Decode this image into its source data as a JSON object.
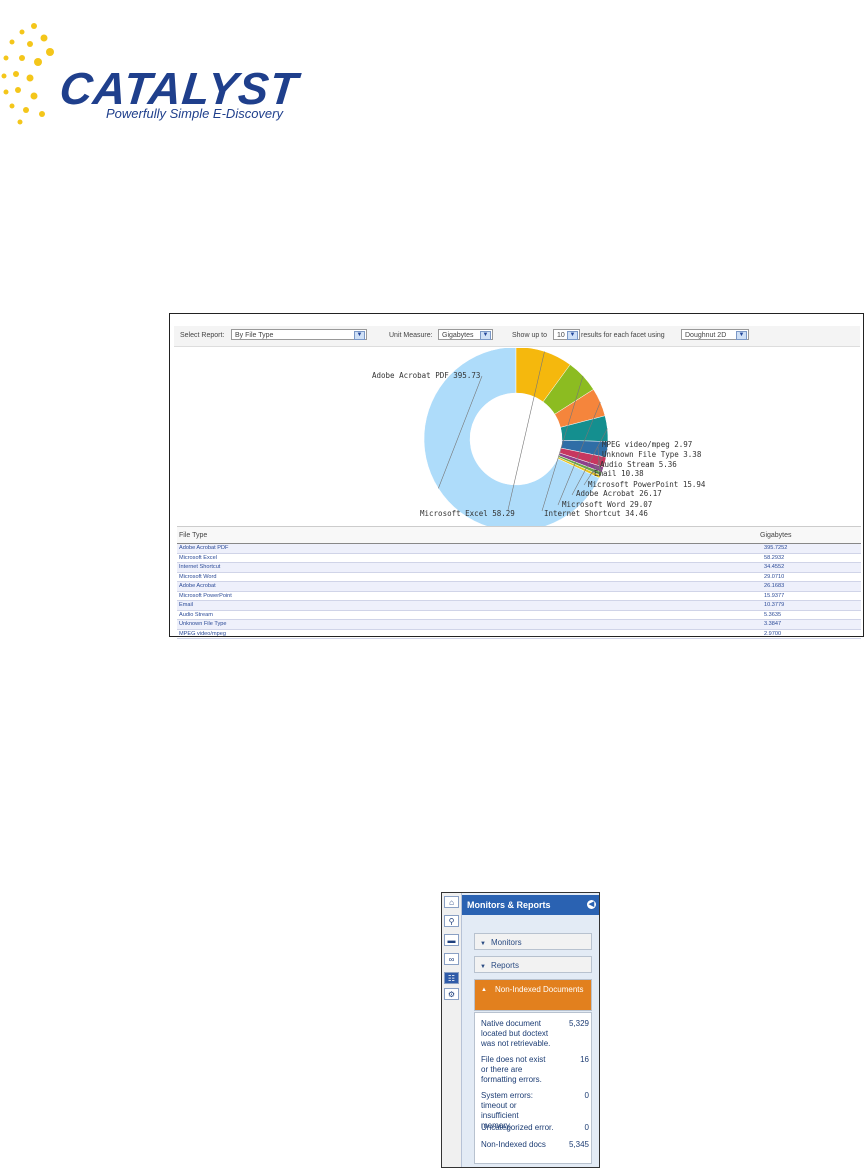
{
  "logo": {
    "brand": "CATALYST",
    "tagline": "Powerfully Simple E-Discovery",
    "colors": {
      "text": "#1f3f8c",
      "rays": "#f4c61a"
    }
  },
  "toolbar": {
    "select_report_label": "Select Report:",
    "select_report_value": "By File Type",
    "unit_label": "Unit Measure:",
    "unit_value": "Gigabytes",
    "show_prefix": "Show up to",
    "show_value": "10",
    "show_suffix": "results for each facet using",
    "chart_type_value": "Doughnut 2D"
  },
  "chart_data": {
    "type": "doughnut",
    "categories": [
      "Adobe Acrobat PDF",
      "Microsoft Excel",
      "Internet Shortcut",
      "Microsoft Word",
      "Adobe Acrobat",
      "Microsoft PowerPoint",
      "Email",
      "Audio Stream",
      "Unknown File Type",
      "MPEG video/mpeg"
    ],
    "values": [
      395.73,
      58.29,
      34.46,
      29.07,
      26.17,
      15.94,
      10.38,
      5.36,
      3.38,
      2.97
    ],
    "labels": [
      "Adobe Acrobat PDF 395.73",
      "Microsoft Excel 58.29",
      "Internet Shortcut 34.46",
      "Microsoft Word 29.07",
      "Adobe Acrobat 26.17",
      "Microsoft PowerPoint 15.94",
      "Email 10.38",
      "Audio Stream 5.36",
      "Unknown File Type 3.38",
      "MPEG video/mpeg 2.97"
    ],
    "colors": [
      "#aedcfa",
      "#f5b80d",
      "#8cbc21",
      "#f5853c",
      "#148f8f",
      "#2f6ea6",
      "#c7375f",
      "#8d3f8c",
      "#6aa845",
      "#e8c422"
    ]
  },
  "table": {
    "col_type": "File Type",
    "col_unit": "Gigabytes",
    "rows": [
      {
        "type": "Adobe Acrobat PDF",
        "value": "395.7252"
      },
      {
        "type": "Microsoft Excel",
        "value": "58.2932"
      },
      {
        "type": "Internet Shortcut",
        "value": "34.4552"
      },
      {
        "type": "Microsoft Word",
        "value": "29.0710"
      },
      {
        "type": "Adobe Acrobat",
        "value": "26.1683"
      },
      {
        "type": "Microsoft PowerPoint",
        "value": "15.9377"
      },
      {
        "type": "Email",
        "value": "10.3779"
      },
      {
        "type": "Audio Stream",
        "value": "5.3635"
      },
      {
        "type": "Unknown File Type",
        "value": "3.3847"
      },
      {
        "type": "MPEG video/mpeg",
        "value": "2.9700"
      }
    ]
  },
  "panel": {
    "title": "Monitors & Reports",
    "monitors": "Monitors",
    "reports": "Reports",
    "non_indexed": "Non-Indexed Documents",
    "entries": [
      {
        "text": "Native document located but doctext was not retrievable.",
        "value": "5,329"
      },
      {
        "text": "File does not exist or there are formatting errors.",
        "value": "16"
      },
      {
        "text": "System errors: timeout or insufficient memory.",
        "value": "0"
      },
      {
        "text": "Uncategorized error.",
        "value": "0"
      },
      {
        "text": "Non-Indexed docs",
        "value": "5,345"
      }
    ],
    "icons": [
      "home-icon",
      "search-icon",
      "folder-icon",
      "binoculars-icon",
      "reports-icon",
      "settings-icon"
    ]
  }
}
